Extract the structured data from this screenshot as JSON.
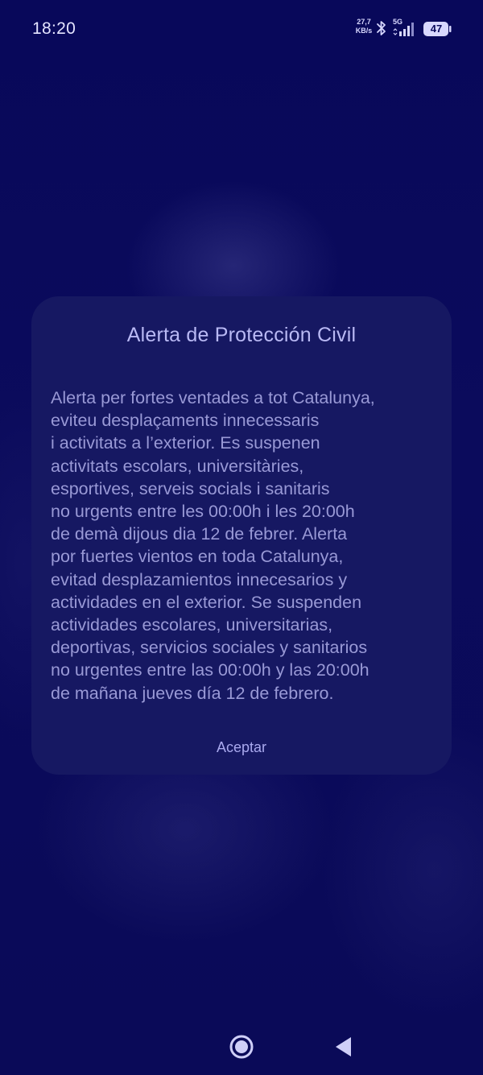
{
  "status_bar": {
    "time": "18:20",
    "network_speed_value": "27,7",
    "network_speed_unit": "KB/s",
    "network_type": "5G",
    "battery_level": "47"
  },
  "dialog": {
    "title": "Alerta de Protección Civil",
    "body": "Alerta per fortes ventades a tot Catalunya,\neviteu desplaçaments innecessaris\ni activitats a l’exterior. Es suspenen\nactivitats escolars, universitàries,\nesportives, serveis socials i sanitaris\nno urgents entre les 00:00h i les 20:00h\nde demà dijous dia 12 de febrer. Alerta\npor fuertes vientos en toda Catalunya,\nevitad desplazamientos innecesarios y\nactividades en el exterior. Se suspenden\nactividades escolares, universitarias,\ndeportivas, servicios sociales y sanitarios\nno urgentes entre las 00:00h y las 20:00h\nde mañana jueves día 12 de febrero.",
    "accept_label": "Aceptar"
  },
  "nav_bar": {
    "home_icon": "home-circle-icon",
    "back_icon": "back-triangle-icon"
  },
  "colors": {
    "background": "#0a0a5a",
    "dialog_background": "#161862",
    "title_text": "#b9b9f4",
    "body_text": "#9999d6",
    "accent": "#a9a9ee"
  }
}
